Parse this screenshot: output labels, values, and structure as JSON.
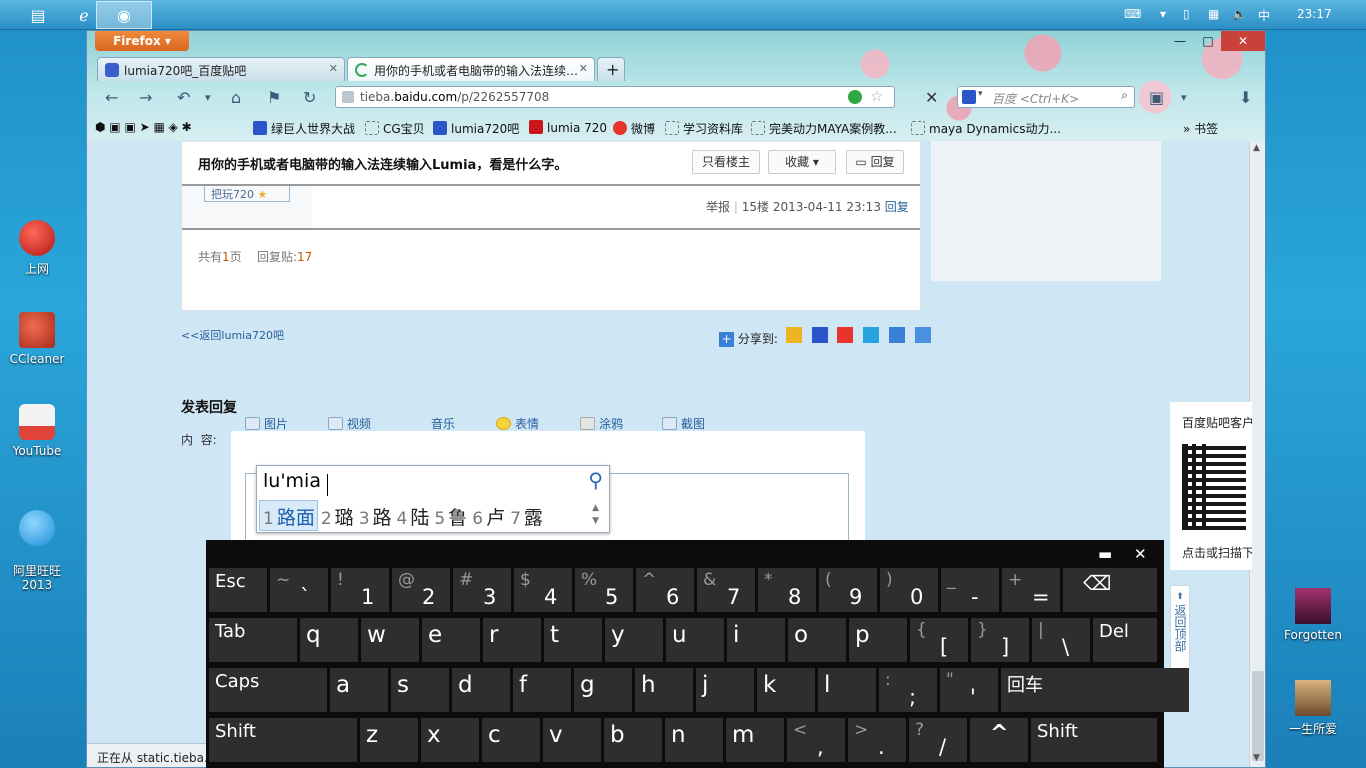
{
  "taskbar": {
    "ime_indicator": "中",
    "clock": "23:17"
  },
  "desktop_icons": [
    {
      "label": "上网",
      "color": "#d8312b"
    },
    {
      "label": "CCleaner",
      "color": "#c8463a"
    },
    {
      "label": "YouTube",
      "color": "#e0433a"
    },
    {
      "label": "阿里旺旺\n2013",
      "color": "#2aa8e8"
    },
    {
      "label": "Forgotten",
      "color": "#7a2b57"
    },
    {
      "label": "一生所爱",
      "color": "#b78b5a"
    }
  ],
  "browser": {
    "menu_button": "Firefox",
    "tabs": [
      {
        "title": "lumia720吧_百度贴吧",
        "selected": false
      },
      {
        "title": "用你的手机或者电脑带的输入法连续…",
        "selected": true
      }
    ],
    "url_prefix": "tieba.",
    "url_domain": "baidu.com",
    "url_path": "/p/2262557708",
    "search_placeholder": "百度 <Ctrl+K>",
    "bookmarks": [
      "绿巨人世界大战",
      "CG宝贝",
      "lumia720吧",
      "lumia 720",
      "微博",
      "学习资料库",
      "完美动力MAYA案例教...",
      "maya Dynamics动力...",
      "书签"
    ],
    "status": "正在从 static.tieba.b"
  },
  "thread": {
    "title": "用你的手机或者电脑带的输入法连续输入Lumia，看是什么字。",
    "btn_only_op": "只看楼主",
    "btn_favorite": "收藏",
    "btn_reply": "回复",
    "user_badge": "把玩720",
    "post_meta_report": "举报",
    "post_meta_floor": "15楼",
    "post_meta_date": "2013-04-11 23:13",
    "post_meta_reply": "回复",
    "total_pages_prefix": "共有",
    "total_pages_num": "1",
    "total_pages_suffix": "页",
    "reply_count_label": "回复贴:",
    "reply_count": "17",
    "back_link": "<<返回lumia720吧",
    "share_label": "分享到:"
  },
  "reply_section": {
    "heading": "发表回复",
    "content_label": "内  容:",
    "tools": [
      "图片",
      "视频",
      "音乐",
      "表情",
      "涂鸦",
      "截图"
    ]
  },
  "ime": {
    "input": "lu'mia",
    "candidates": [
      {
        "n": "1",
        "text": "路面",
        "selected": true
      },
      {
        "n": "2",
        "text": "璐"
      },
      {
        "n": "3",
        "text": "路"
      },
      {
        "n": "4",
        "text": "陆"
      },
      {
        "n": "5",
        "text": "鲁"
      },
      {
        "n": "6",
        "text": "卢"
      },
      {
        "n": "7",
        "text": "露"
      }
    ]
  },
  "side_widget": {
    "title": "百度贴吧客户",
    "caption": "点击或扫描下",
    "back_to_top": "返回顶部"
  },
  "keyboard": {
    "row1": [
      {
        "label": "Esc"
      },
      {
        "alt": "~",
        "main": "`"
      },
      {
        "alt": "!",
        "main": "1"
      },
      {
        "alt": "@",
        "main": "2"
      },
      {
        "alt": "#",
        "main": "3"
      },
      {
        "alt": "$",
        "main": "4"
      },
      {
        "alt": "%",
        "main": "5"
      },
      {
        "alt": "^",
        "main": "6"
      },
      {
        "alt": "&",
        "main": "7"
      },
      {
        "alt": "*",
        "main": "8"
      },
      {
        "alt": "(",
        "main": "9"
      },
      {
        "alt": ")",
        "main": "0"
      },
      {
        "alt": "_",
        "main": "-"
      },
      {
        "alt": "+",
        "main": "="
      },
      {
        "label": "⌫"
      }
    ],
    "row2": [
      {
        "label": "Tab"
      },
      {
        "label": "q"
      },
      {
        "label": "w"
      },
      {
        "label": "e"
      },
      {
        "label": "r"
      },
      {
        "label": "t"
      },
      {
        "label": "y"
      },
      {
        "label": "u"
      },
      {
        "label": "i"
      },
      {
        "label": "o"
      },
      {
        "label": "p"
      },
      {
        "alt": "{",
        "main": "["
      },
      {
        "alt": "}",
        "main": "]"
      },
      {
        "alt": "|",
        "main": "\\"
      },
      {
        "label": "Del"
      }
    ],
    "row3": [
      {
        "label": "Caps"
      },
      {
        "label": "a"
      },
      {
        "label": "s"
      },
      {
        "label": "d"
      },
      {
        "label": "f"
      },
      {
        "label": "g"
      },
      {
        "label": "h"
      },
      {
        "label": "j"
      },
      {
        "label": "k"
      },
      {
        "label": "l"
      },
      {
        "alt": ":",
        "main": ";"
      },
      {
        "alt": "\"",
        "main": "'"
      },
      {
        "label": "回车"
      }
    ],
    "row4": [
      {
        "label": "Shift"
      },
      {
        "label": "z"
      },
      {
        "label": "x"
      },
      {
        "label": "c"
      },
      {
        "label": "v"
      },
      {
        "label": "b"
      },
      {
        "label": "n"
      },
      {
        "label": "m"
      },
      {
        "alt": "<",
        "main": ","
      },
      {
        "alt": ">",
        "main": "."
      },
      {
        "alt": "?",
        "main": "/"
      },
      {
        "label": "^"
      },
      {
        "label": "Shift"
      }
    ]
  }
}
